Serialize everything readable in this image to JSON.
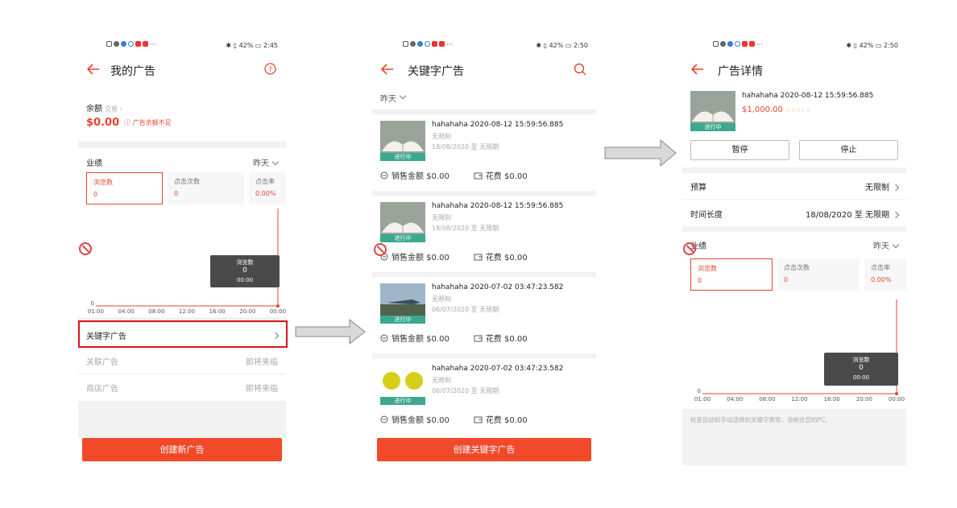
{
  "status": {
    "left_time": "2:45",
    "mid_time": "2:50",
    "right_time": "2:50",
    "battery": "42%"
  },
  "p1": {
    "title": "我的广告",
    "balance_label": "余额",
    "trade_link": "交易 ›",
    "balance": "$0.00",
    "warning": "广告余额不足",
    "perf_label": "业绩",
    "range": "昨天",
    "metrics": [
      {
        "label": "浏览数",
        "value": "0"
      },
      {
        "label": "点击次数",
        "value": "0"
      },
      {
        "label": "点击率",
        "value": "0.00%"
      }
    ],
    "chart": {
      "type": "line",
      "x": [
        "01:00",
        "04:00",
        "08:00",
        "12:00",
        "16:00",
        "20:00",
        "00:00"
      ],
      "y_tick": "0",
      "tooltip_title": "浏览数",
      "tooltip_value": "0",
      "tooltip_time": "00:00"
    },
    "menu": [
      {
        "label": "关键字广告",
        "right": ""
      },
      {
        "label": "关联广告",
        "right": "即将来临"
      },
      {
        "label": "商店广告",
        "right": "即将来临"
      }
    ],
    "create_btn": "创建新广告"
  },
  "p2": {
    "title": "关键字广告",
    "range": "昨天",
    "ads": [
      {
        "name": "hahahaha 2020-08-12 15:59:56.885",
        "limit": "无限制",
        "period": "18/08/2020 至 无限期",
        "badge": "进行中",
        "sales": "销售金额 $0.00",
        "cost": "花费 $0.00"
      },
      {
        "name": "hahahaha 2020-08-12 15:59:56.885",
        "limit": "无限制",
        "period": "18/08/2020 至 无限期",
        "badge": "进行中",
        "sales": "销售金额 $0.00",
        "cost": "花费 $0.00"
      },
      {
        "name": "hahahaha 2020-07-02 03:47:23.582",
        "limit": "无限制",
        "period": "06/07/2020 至 无限期",
        "badge": "进行中",
        "sales": "销售金额 $0.00",
        "cost": "花费 $0.00"
      },
      {
        "name": "hahahaha 2020-07-02 03:47:23.582",
        "limit": "无限制",
        "period": "06/07/2020 至 无限期",
        "badge": "进行中",
        "sales": "销售金额 $0.00",
        "cost": "花费 $0.00"
      }
    ],
    "create_btn": "创建关键字广告"
  },
  "p3": {
    "title": "广告详情",
    "ad_name": "hahahaha 2020-08-12 15:59:56.885",
    "price": "$1,000.00",
    "badge": "进行中",
    "pause": "暂停",
    "stop": "停止",
    "budget_label": "预算",
    "budget_value": "无限制",
    "duration_label": "时间长度",
    "duration_value": "18/08/2020 至 无限期",
    "perf_label": "业绩",
    "range": "昨天",
    "metrics": [
      {
        "label": "浏览数",
        "value": "0"
      },
      {
        "label": "点击次数",
        "value": "0"
      },
      {
        "label": "点击率",
        "value": "0.00%"
      }
    ],
    "chart": {
      "type": "line",
      "x": [
        "01:00",
        "04:00",
        "08:00",
        "12:00",
        "16:00",
        "20:00",
        "00:00"
      ],
      "y_tick": "0",
      "tooltip_title": "浏览数",
      "tooltip_value": "0",
      "tooltip_time": "00:00"
    },
    "note": "检查自动和手动选择的关键字表现，请前往您的PC。"
  },
  "colors": {
    "accent": "#e8452c",
    "badge": "#3aa98e"
  }
}
